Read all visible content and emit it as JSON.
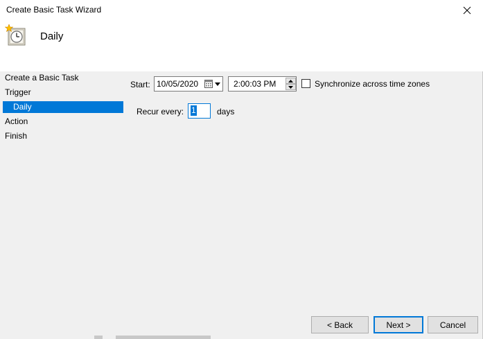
{
  "window": {
    "title": "Create Basic Task Wizard"
  },
  "header": {
    "title": "Daily",
    "icon": "task-scheduler-clock-icon"
  },
  "steps": [
    {
      "label": "Create a Basic Task"
    },
    {
      "label": "Trigger"
    },
    {
      "label": "Daily",
      "selected": true
    },
    {
      "label": "Action"
    },
    {
      "label": "Finish"
    }
  ],
  "form": {
    "start_label": "Start:",
    "start_date": "10/05/2020",
    "start_time": "2:00:03 PM",
    "sync_label": "Synchronize across time zones",
    "sync_checked": false,
    "recur_label": "Recur every:",
    "recur_value": "1",
    "recur_unit": "days"
  },
  "buttons": {
    "back": "< Back",
    "next": "Next >",
    "cancel": "Cancel"
  },
  "colors": {
    "selection": "#0078d7",
    "header_bg": "#ffffff",
    "body_bg": "#f0f0f0"
  }
}
